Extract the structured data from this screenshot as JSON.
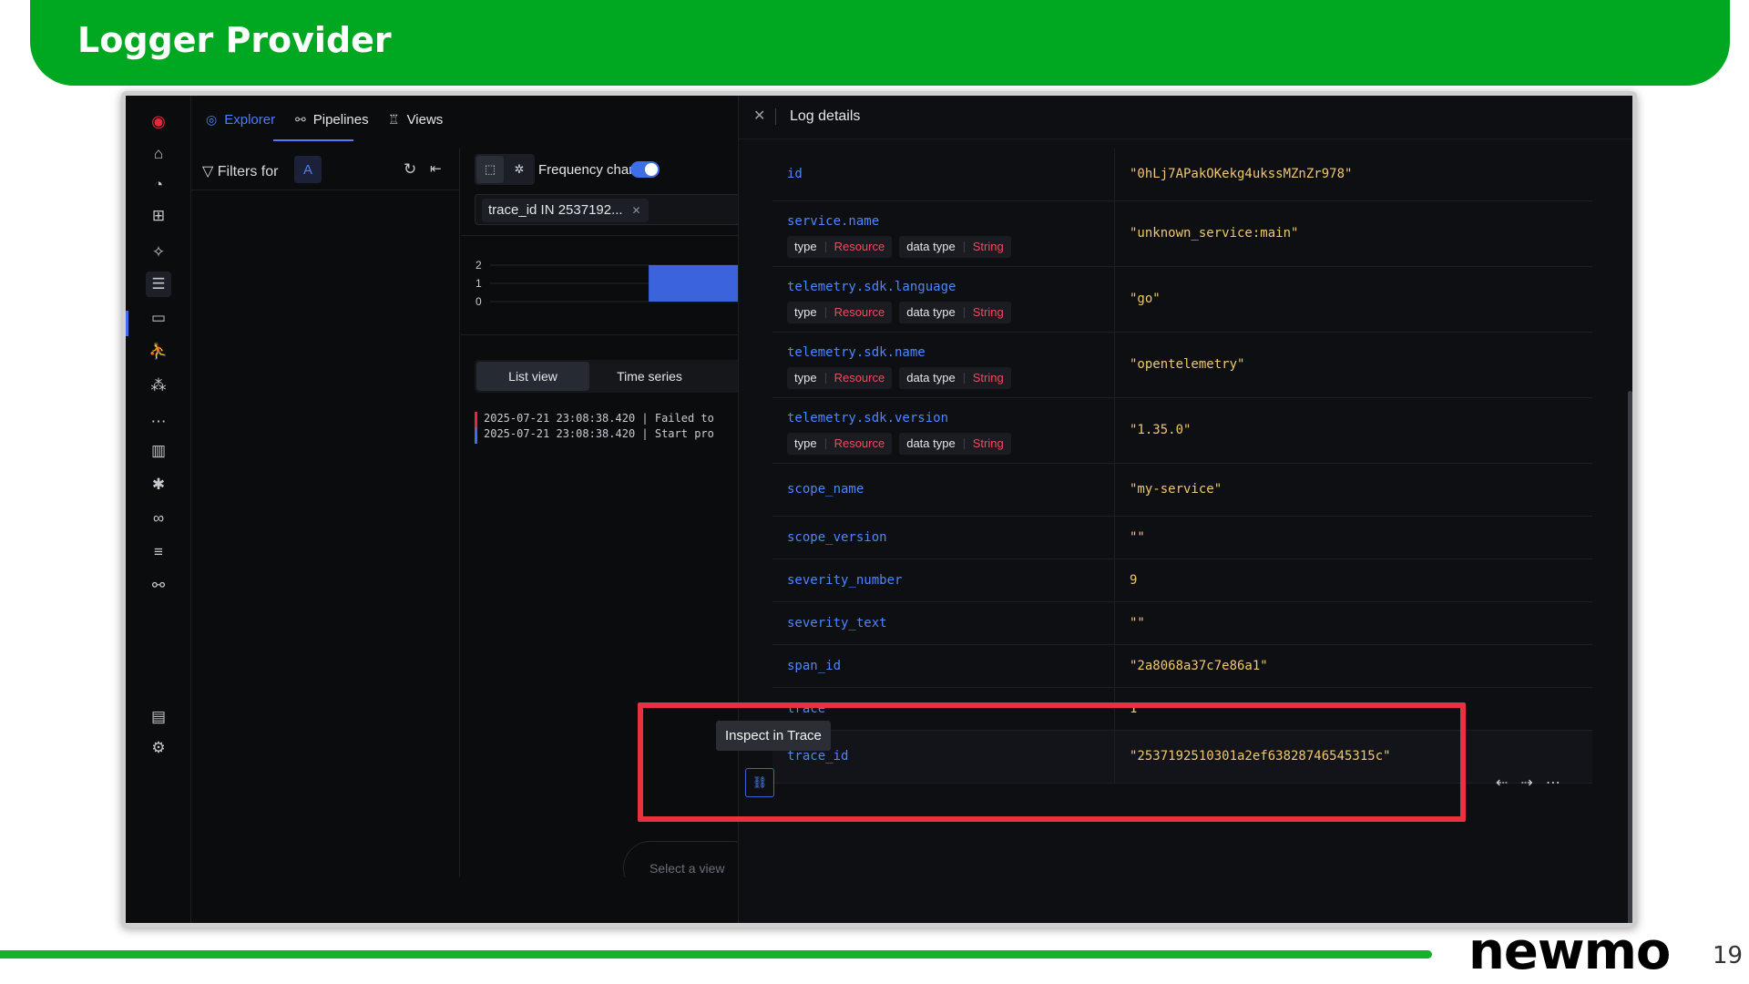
{
  "slide": {
    "title": "Logger Provider",
    "brand": "newmo",
    "page_number": "19",
    "colors": {
      "banner": "#00a822",
      "highlight": "#e8323f"
    }
  },
  "sidebar": {
    "logo": "signoz-logo-icon",
    "icons": [
      "home-icon",
      "bell-icon",
      "grid-icon",
      "sparkle-icon",
      "logs-icon",
      "inbox-icon",
      "person-icon",
      "network-icon",
      "more-icon",
      "bar-chart-icon",
      "bug-icon",
      "binoculars-icon",
      "list-icon",
      "pipeline-icon",
      "comment-icon",
      "gear-icon"
    ]
  },
  "tabs": [
    {
      "label": "Explorer",
      "icon": "compass-icon"
    },
    {
      "label": "Pipelines",
      "icon": "pipeline-icon"
    },
    {
      "label": "Views",
      "icon": "views-icon"
    }
  ],
  "filters": {
    "label": "Filters for",
    "query_letter": "A"
  },
  "results": {
    "frequency_label": "Frequency chart",
    "frequency_enabled": true,
    "query_chip": "trace_id IN 2537192...",
    "chart_y_ticks": [
      "2",
      "1",
      "0"
    ],
    "list_tabs": [
      "List view",
      "Time series"
    ],
    "logs": [
      {
        "level": "error",
        "text": "2025-07-21 23:08:38.420 | Failed to"
      },
      {
        "level": "info",
        "text": "2025-07-21 23:08:38.420 | Start pro"
      }
    ],
    "select_view_placeholder": "Select a view"
  },
  "chart_data": {
    "type": "bar",
    "title": "",
    "ylim": [
      0,
      2
    ],
    "y_ticks": [
      2,
      1,
      0
    ],
    "series": [
      {
        "values": [
          0,
          2
        ]
      }
    ]
  },
  "drawer": {
    "title": "Log details",
    "tag_type_label": "type",
    "tag_type_value": "Resource",
    "tag_dtype_label": "data type",
    "tag_dtype_value": "String",
    "rows": [
      {
        "key": "id",
        "value": "\"0hLj7APakOKekg4ukssMZnZr978\""
      },
      {
        "key": "service.name",
        "value": "\"unknown_service:main\"",
        "tags": true
      },
      {
        "key": "telemetry.sdk.language",
        "value": "\"go\"",
        "tags": true
      },
      {
        "key": "telemetry.sdk.name",
        "value": "\"opentelemetry\"",
        "tags": true
      },
      {
        "key": "telemetry.sdk.version",
        "value": "\"1.35.0\"",
        "tags": true
      },
      {
        "key": "scope_name",
        "value": "\"my-service\""
      },
      {
        "key": "scope_version",
        "value": "\"\""
      },
      {
        "key": "severity_number",
        "value": "9"
      },
      {
        "key": "severity_text",
        "value": "\"\""
      },
      {
        "key": "span_id",
        "value": "\"2a8068a37c7e86a1\""
      },
      {
        "key": "trace",
        "value": "1"
      },
      {
        "key": "trace_id",
        "value": "\"2537192510301a2ef63828746545315c\""
      }
    ],
    "tooltip": "Inspect in Trace"
  }
}
